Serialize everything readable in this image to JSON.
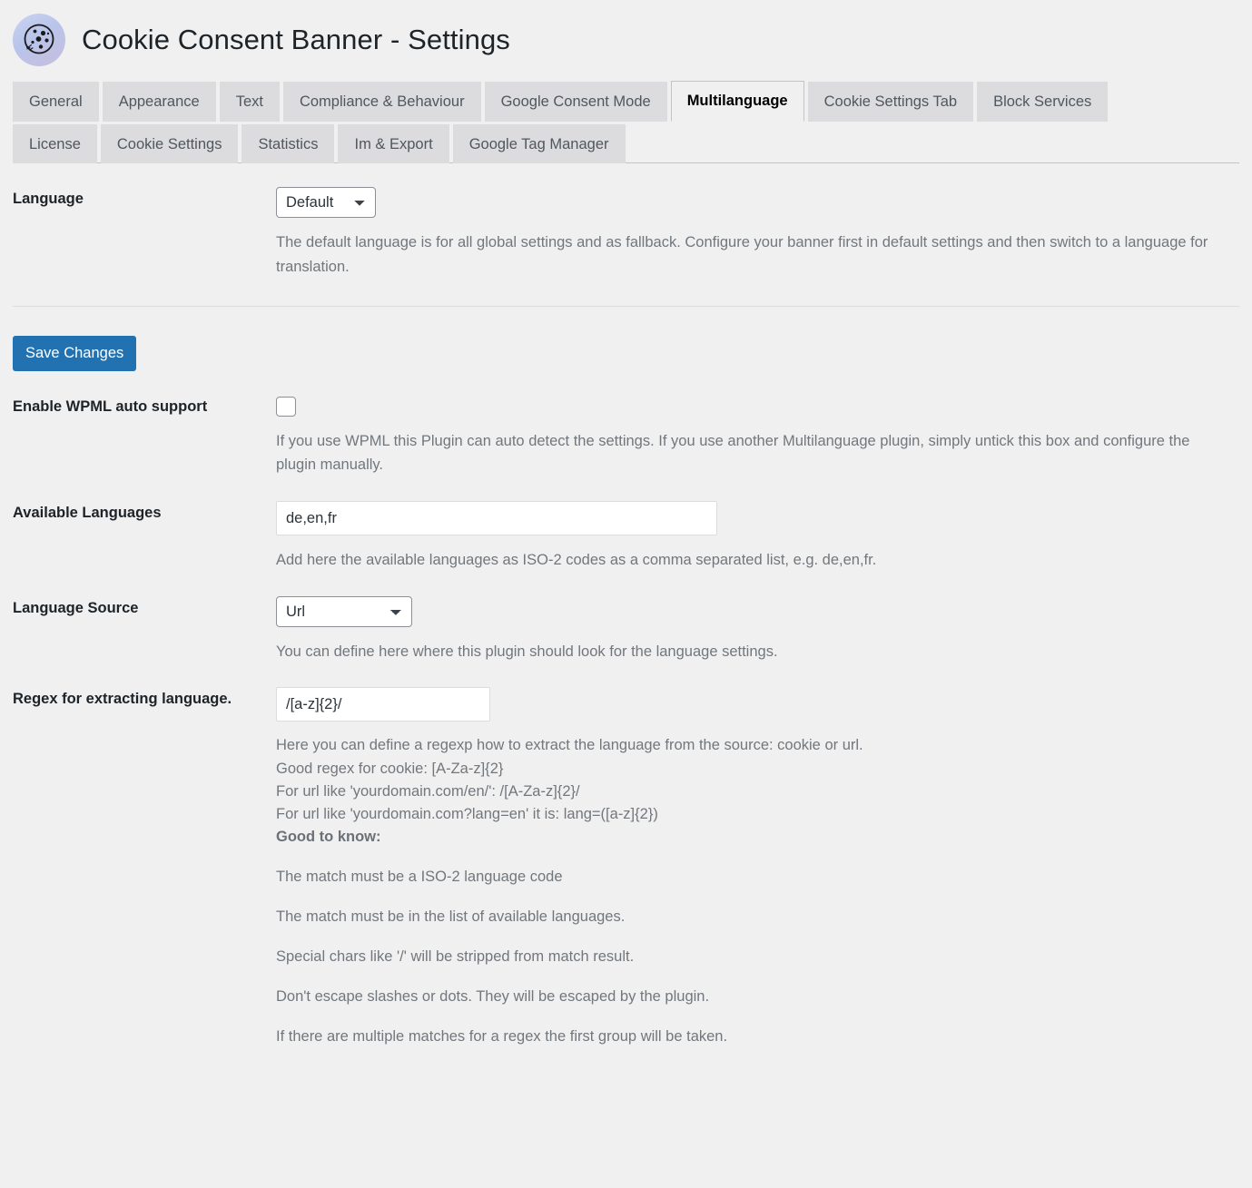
{
  "header": {
    "title": "Cookie Consent Banner - Settings",
    "logo_icon": "cookie-icon"
  },
  "tabs": {
    "row1": [
      {
        "label": "General",
        "active": false
      },
      {
        "label": "Appearance",
        "active": false
      },
      {
        "label": "Text",
        "active": false
      },
      {
        "label": "Compliance & Behaviour",
        "active": false
      },
      {
        "label": "Google Consent Mode",
        "active": false
      },
      {
        "label": "Multilanguage",
        "active": true
      },
      {
        "label": "Cookie Settings Tab",
        "active": false
      },
      {
        "label": "Block Services",
        "active": false
      }
    ],
    "row2": [
      {
        "label": "License",
        "active": false
      },
      {
        "label": "Cookie Settings",
        "active": false
      },
      {
        "label": "Statistics",
        "active": false
      },
      {
        "label": "Im & Export",
        "active": false
      },
      {
        "label": "Google Tag Manager",
        "active": false
      }
    ]
  },
  "fields": {
    "language": {
      "label": "Language",
      "value": "Default",
      "options": [
        "Default"
      ],
      "description": "The default language is for all global settings and as fallback. Configure your banner first in default settings and then switch to a language for translation."
    },
    "wpml": {
      "label": "Enable WPML auto support",
      "checked": false,
      "description": "If you use WPML this Plugin can auto detect the settings. If you use another Multilanguage plugin, simply untick this box and configure the plugin manually."
    },
    "available_languages": {
      "label": "Available Languages",
      "value": "de,en,fr",
      "description": "Add here the available languages as ISO-2 codes as a comma separated list, e.g. de,en,fr."
    },
    "language_source": {
      "label": "Language Source",
      "value": "Url",
      "options": [
        "Url"
      ],
      "description": "You can define here where this plugin should look for the language settings."
    },
    "regex": {
      "label": "Regex for extracting language.",
      "value": "/[a-z]{2}/",
      "desc_line1": "Here you can define a regexp how to extract the language from the source: cookie or url.",
      "desc_line2": "Good regex for cookie: [A-Za-z]{2}",
      "desc_line3": "For url like 'yourdomain.com/en/': /[A-Za-z]{2}/",
      "desc_line4": "For url like 'yourdomain.com?lang=en' it is: lang=([a-z]{2})",
      "desc_line5": "Good to know:",
      "notes": [
        "The match must be a ISO-2 language code",
        "The match must be in the list of available languages.",
        "Special chars like '/' will be stripped from match result.",
        "Don't escape slashes or dots. They will be escaped by the plugin.",
        "If there are multiple matches for a regex the first group will be taken."
      ]
    }
  },
  "buttons": {
    "save": "Save Changes"
  },
  "colors": {
    "accent": "#2271b1",
    "page_bg": "#f0f0f1",
    "tab_bg": "#dcdcde",
    "text": "#1d2327",
    "muted_text": "#72777c"
  }
}
